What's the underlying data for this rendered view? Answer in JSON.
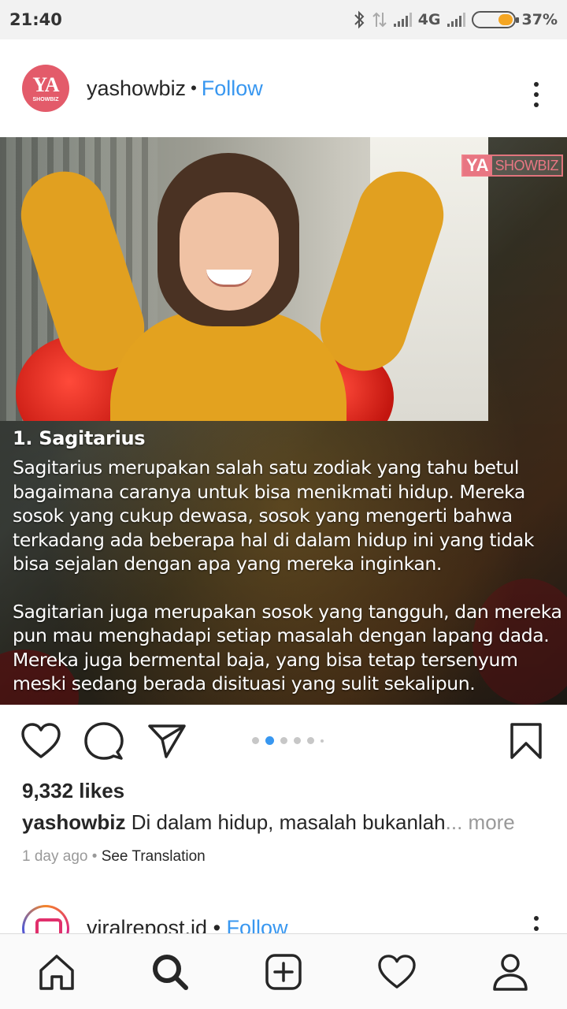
{
  "status_bar": {
    "time": "21:40",
    "network": "4G",
    "battery_percent": "37%",
    "battery_level": 0.37,
    "icons": [
      "bluetooth-icon",
      "data-transfer-icon",
      "signal-icon",
      "signal-icon",
      "battery-icon"
    ]
  },
  "post": {
    "avatar_text": "YA",
    "avatar_subtext": "SHOWBIZ",
    "username": "yashowbiz",
    "separator": "•",
    "follow_label": "Follow",
    "image": {
      "watermark_ya": "YA",
      "watermark_showbiz": "SHOWBIZ",
      "heading": "1. Sagitarius",
      "paragraphs": [
        [
          "Sagitarius merupakan salah satu zodiak yang tahu betul",
          "bagaimana caranya untuk bisa menikmati hidup. Mereka",
          "sosok yang cukup dewasa, sosok yang mengerti bahwa",
          "terkadang ada beberapa hal di dalam hidup ini yang tidak",
          "bisa sejalan dengan apa yang mereka inginkan."
        ],
        [
          "Sagitarian juga merupakan sosok yang tangguh, dan mereka",
          "pun mau menghadapi setiap masalah dengan lapang dada.",
          "Mereka juga bermental baja, yang bisa tetap tersenyum",
          "meski sedang berada disituasi yang sulit sekalipun."
        ]
      ]
    },
    "carousel": {
      "count": 6,
      "active_index": 1
    },
    "likes": "9,332 likes",
    "caption_user": "yashowbiz",
    "caption_text": "Di dalam hidup, masalah bukanlah",
    "caption_more": "... more",
    "time_ago": "1 day ago",
    "meta_separator": "•",
    "see_translation": "See Translation"
  },
  "next_post": {
    "username": "viralrepost.id",
    "separator": "•",
    "follow_label": "Follow"
  },
  "bottom_nav": {
    "items": [
      "home-icon",
      "search-icon",
      "new-post-icon",
      "activity-heart-icon",
      "profile-icon"
    ],
    "active": "search-icon"
  },
  "colors": {
    "accent_blue": "#3897f0",
    "brand_pink": "#e35b6a",
    "text": "#262626",
    "muted": "#999999"
  }
}
